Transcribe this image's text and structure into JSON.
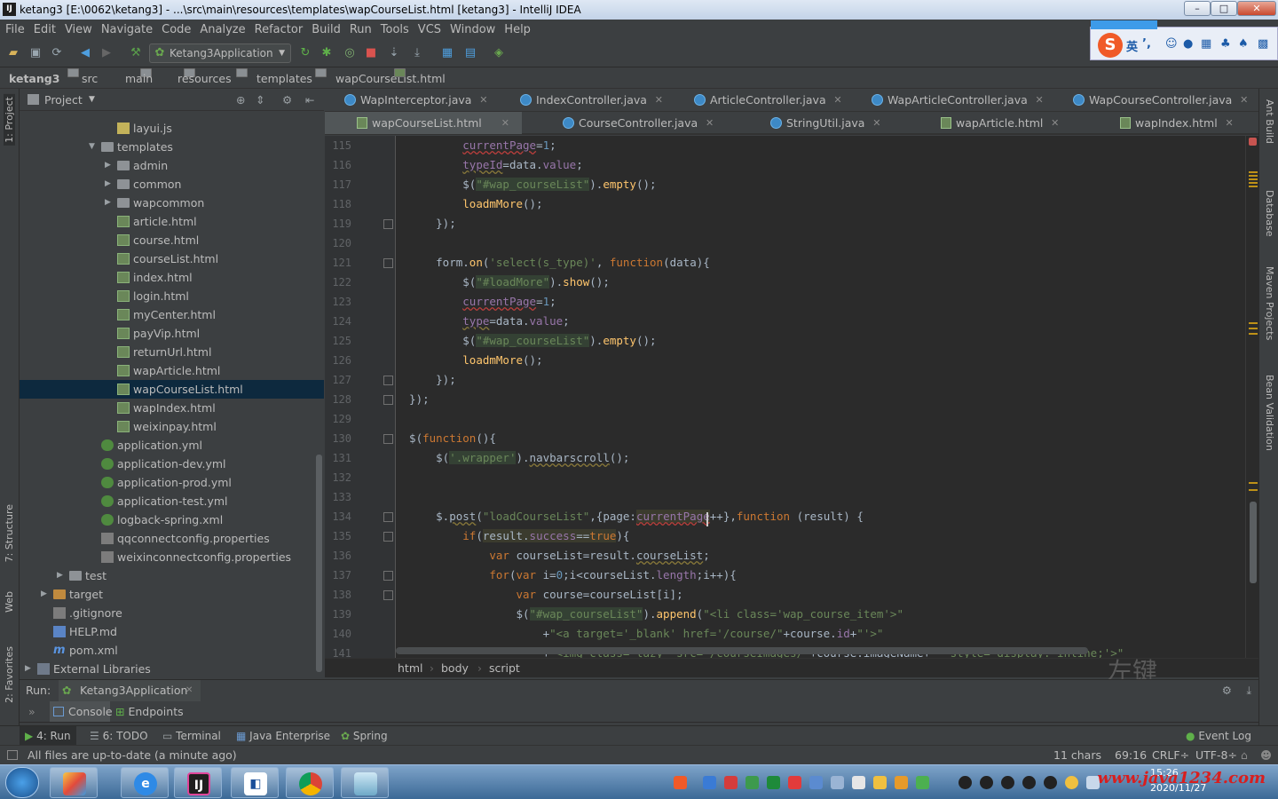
{
  "window": {
    "title": "ketang3 [E:\\0062\\ketang3] - ...\\src\\main\\resources\\templates\\wapCourseList.html [ketang3] - IntelliJ IDEA",
    "app_icon": "IJ",
    "minimize": "–",
    "maximize": "□",
    "close": "✕"
  },
  "menu": [
    "File",
    "Edit",
    "View",
    "Navigate",
    "Code",
    "Analyze",
    "Refactor",
    "Build",
    "Run",
    "Tools",
    "VCS",
    "Window",
    "Help"
  ],
  "toolbar": {
    "run_config": "Ketang3Application"
  },
  "ime": {
    "lang": "英",
    "punct": "’,"
  },
  "breadcrumb": [
    "ketang3",
    "src",
    "main",
    "resources",
    "templates",
    "wapCourseList.html"
  ],
  "left_strip": {
    "project": "1: Project",
    "structure": "7: Structure",
    "web": "Web",
    "favorites": "2: Favorites"
  },
  "right_strip": {
    "ant": "Ant Build",
    "database": "Database",
    "maven": "Maven Projects",
    "bean": "Bean Validation"
  },
  "project_panel": {
    "title": "Project"
  },
  "tree": [
    {
      "label": "layui.js",
      "icon": "js",
      "depth": 5,
      "arrow": ""
    },
    {
      "label": "templates",
      "icon": "folder",
      "depth": 4,
      "arrow": "▼"
    },
    {
      "label": "admin",
      "icon": "folder",
      "depth": 5,
      "arrow": "▶"
    },
    {
      "label": "common",
      "icon": "folder",
      "depth": 5,
      "arrow": "▶"
    },
    {
      "label": "wapcommon",
      "icon": "folder",
      "depth": 5,
      "arrow": "▶"
    },
    {
      "label": "article.html",
      "icon": "html",
      "depth": 5,
      "arrow": ""
    },
    {
      "label": "course.html",
      "icon": "html",
      "depth": 5,
      "arrow": ""
    },
    {
      "label": "courseList.html",
      "icon": "html",
      "depth": 5,
      "arrow": ""
    },
    {
      "label": "index.html",
      "icon": "html",
      "depth": 5,
      "arrow": ""
    },
    {
      "label": "login.html",
      "icon": "html",
      "depth": 5,
      "arrow": ""
    },
    {
      "label": "myCenter.html",
      "icon": "html",
      "depth": 5,
      "arrow": ""
    },
    {
      "label": "payVip.html",
      "icon": "html",
      "depth": 5,
      "arrow": ""
    },
    {
      "label": "returnUrl.html",
      "icon": "html",
      "depth": 5,
      "arrow": ""
    },
    {
      "label": "wapArticle.html",
      "icon": "html",
      "depth": 5,
      "arrow": ""
    },
    {
      "label": "wapCourseList.html",
      "icon": "html",
      "depth": 5,
      "arrow": "",
      "selected": true
    },
    {
      "label": "wapIndex.html",
      "icon": "html",
      "depth": 5,
      "arrow": ""
    },
    {
      "label": "weixinpay.html",
      "icon": "html",
      "depth": 5,
      "arrow": ""
    },
    {
      "label": "application.yml",
      "icon": "yml",
      "depth": 4,
      "arrow": ""
    },
    {
      "label": "application-dev.yml",
      "icon": "yml",
      "depth": 4,
      "arrow": ""
    },
    {
      "label": "application-prod.yml",
      "icon": "yml",
      "depth": 4,
      "arrow": ""
    },
    {
      "label": "application-test.yml",
      "icon": "yml",
      "depth": 4,
      "arrow": ""
    },
    {
      "label": "logback-spring.xml",
      "icon": "xml",
      "depth": 4,
      "arrow": ""
    },
    {
      "label": "qqconnectconfig.properties",
      "icon": "prop",
      "depth": 4,
      "arrow": ""
    },
    {
      "label": "weixinconnectconfig.properties",
      "icon": "prop",
      "depth": 4,
      "arrow": ""
    },
    {
      "label": "test",
      "icon": "folder",
      "depth": 2,
      "arrow": "▶"
    },
    {
      "label": "target",
      "icon": "folder-orange",
      "depth": 1,
      "arrow": "▶"
    },
    {
      "label": ".gitignore",
      "icon": "prop",
      "depth": 1,
      "arrow": ""
    },
    {
      "label": "HELP.md",
      "icon": "md",
      "depth": 1,
      "arrow": ""
    },
    {
      "label": "pom.xml",
      "icon": "m",
      "depth": 1,
      "arrow": ""
    },
    {
      "label": "External Libraries",
      "icon": "lib",
      "depth": 0,
      "arrow": "▶"
    }
  ],
  "tabs_row1": [
    {
      "label": "WapInterceptor.java",
      "kind": "java"
    },
    {
      "label": "IndexController.java",
      "kind": "java"
    },
    {
      "label": "ArticleController.java",
      "kind": "java"
    },
    {
      "label": "WapArticleController.java",
      "kind": "java"
    },
    {
      "label": "WapCourseController.java",
      "kind": "java"
    }
  ],
  "tabs_row2": [
    {
      "label": "wapCourseList.html",
      "kind": "html",
      "active": true
    },
    {
      "label": "CourseController.java",
      "kind": "java"
    },
    {
      "label": "StringUtil.java",
      "kind": "java"
    },
    {
      "label": "wapArticle.html",
      "kind": "html"
    },
    {
      "label": "wapIndex.html",
      "kind": "html"
    }
  ],
  "line_numbers": [
    "115",
    "116",
    "117",
    "118",
    "119",
    "120",
    "121",
    "122",
    "123",
    "124",
    "125",
    "126",
    "127",
    "128",
    "129",
    "130",
    "131",
    "132",
    "133",
    "134",
    "135",
    "136",
    "137",
    "138",
    "139",
    "140",
    "141"
  ],
  "code_breadcrumb": [
    "html",
    "body",
    "script"
  ],
  "run_bar": {
    "label": "Run:",
    "config": "Ketang3Application"
  },
  "console_bar": {
    "console": "Console",
    "endpoints": "Endpoints"
  },
  "tool_tabs": [
    "4: Run",
    "6: TODO",
    "Terminal",
    "Java Enterprise",
    "Spring"
  ],
  "event_log": "Event Log",
  "status": {
    "message": "All files are up-to-date (a minute ago)",
    "chars": "11 chars",
    "position": "69:16",
    "line_sep": "CRLF÷",
    "encoding": "UTF-8÷"
  },
  "overlay_hint": "左键",
  "taskbar": {
    "date": "2020/11/27",
    "time": "15:26",
    "watermark": "www.java1234.com"
  }
}
